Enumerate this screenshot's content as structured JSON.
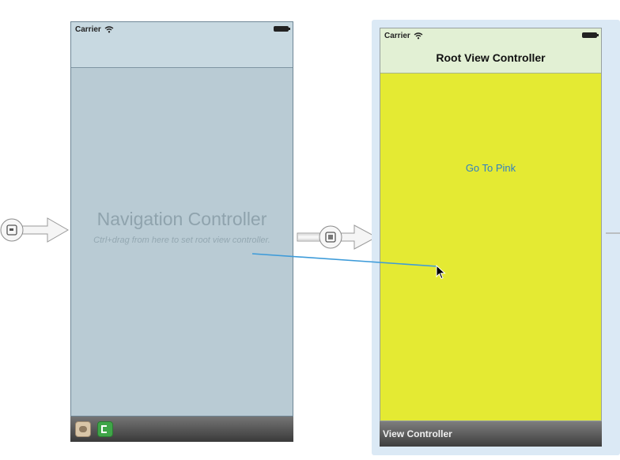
{
  "nav_controller": {
    "carrier": "Carrier",
    "title": "Navigation Controller",
    "hint": "Ctrl+drag from here to set root view controller."
  },
  "root_controller": {
    "carrier": "Carrier",
    "nav_title": "Root View Controller",
    "button_label": "Go To Pink",
    "dock_label": "View Controller"
  },
  "colors": {
    "nav_background": "#b9cbd4",
    "root_view_background": "#e4ea33",
    "button_text": "#2f7fc4",
    "drag_line": "#3d9bd9"
  },
  "icons": {
    "entry_point": "storyboard-entry-icon",
    "segue": "relationship-segue-icon",
    "dock_first_responder": "first-responder-icon",
    "dock_exit": "exit-icon"
  }
}
